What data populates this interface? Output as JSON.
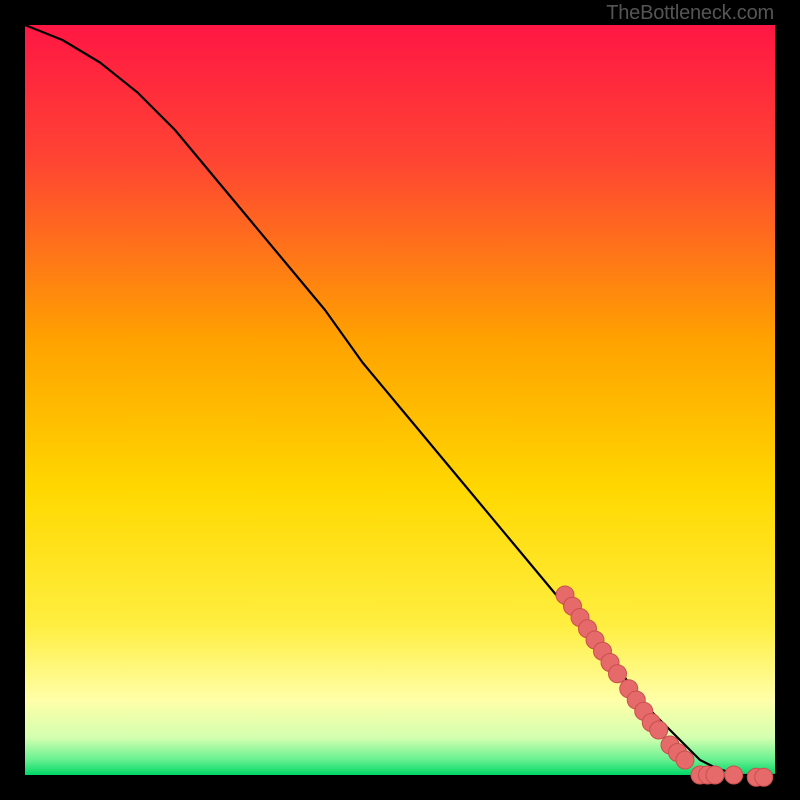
{
  "attribution": "TheBottleneck.com",
  "colors": {
    "bg": "#000000",
    "gradient_top": "#ff1744",
    "gradient_upper": "#ff5131",
    "gradient_mid": "#ffb000",
    "gradient_lower": "#ffe600",
    "gradient_pale": "#ffffb0",
    "gradient_bottom": "#00e676",
    "curve": "#000000",
    "marker_fill": "#e66a6a",
    "marker_stroke": "#c94f4f"
  },
  "chart_data": {
    "type": "line",
    "title": "",
    "xlabel": "",
    "ylabel": "",
    "xlim": [
      0,
      100
    ],
    "ylim": [
      0,
      100
    ],
    "series": [
      {
        "name": "bottleneck-curve",
        "x": [
          0,
          5,
          10,
          15,
          20,
          25,
          30,
          35,
          40,
          45,
          50,
          55,
          60,
          65,
          70,
          75,
          80,
          82,
          85,
          88,
          90,
          92,
          95,
          100
        ],
        "y": [
          100,
          98,
          95,
          91,
          86,
          80,
          74,
          68,
          62,
          55,
          49,
          43,
          37,
          31,
          25,
          19,
          13,
          10,
          7,
          4,
          2,
          1,
          0,
          0
        ]
      }
    ],
    "markers": [
      {
        "x": 72,
        "y": 24
      },
      {
        "x": 73,
        "y": 22.5
      },
      {
        "x": 74,
        "y": 21
      },
      {
        "x": 75,
        "y": 19.5
      },
      {
        "x": 76,
        "y": 18
      },
      {
        "x": 77,
        "y": 16.5
      },
      {
        "x": 78,
        "y": 15
      },
      {
        "x": 79,
        "y": 13.5
      },
      {
        "x": 80.5,
        "y": 11.5
      },
      {
        "x": 81.5,
        "y": 10
      },
      {
        "x": 82.5,
        "y": 8.5
      },
      {
        "x": 83.5,
        "y": 7
      },
      {
        "x": 84.5,
        "y": 6
      },
      {
        "x": 86,
        "y": 4
      },
      {
        "x": 87,
        "y": 3
      },
      {
        "x": 88,
        "y": 2
      },
      {
        "x": 90,
        "y": 0
      },
      {
        "x": 91,
        "y": 0
      },
      {
        "x": 92,
        "y": 0
      },
      {
        "x": 94.5,
        "y": 0
      },
      {
        "x": 97.5,
        "y": -0.3
      },
      {
        "x": 98.5,
        "y": -0.3
      }
    ]
  }
}
